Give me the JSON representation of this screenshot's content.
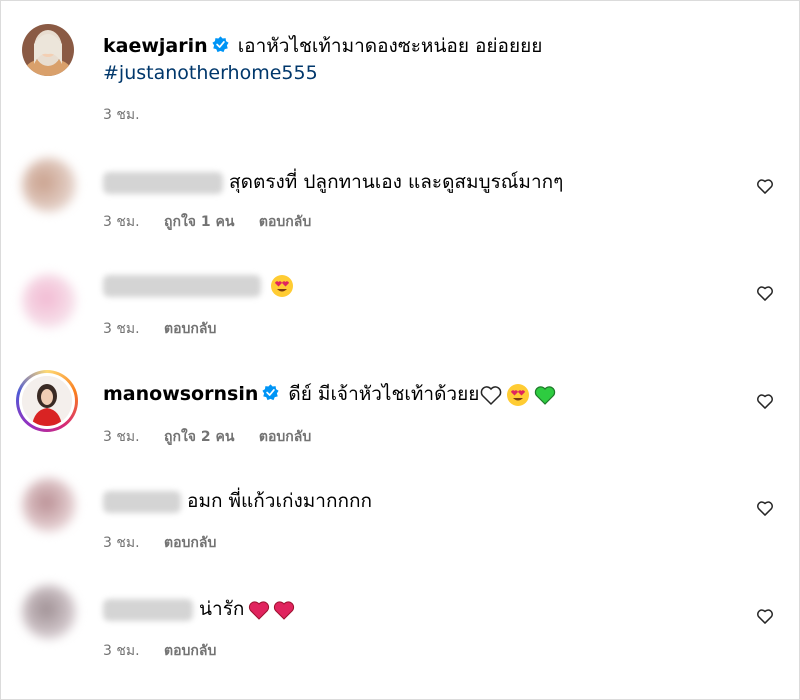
{
  "caption": {
    "username": "kaewjarin",
    "text": "เอาหัวไชเท้ามาดองซะหน่อย อย่อยยย",
    "hashtag": "#justanotherhome555",
    "time": "3 ชม."
  },
  "comments": [
    {
      "text": "สุดตรงที่ ปลูกทานเอง และดูสมบูรณ์มากๆ",
      "time": "3 ชม.",
      "likes": "ถูกใจ 1 คน",
      "reply": "ตอบกลับ"
    },
    {
      "text": "",
      "time": "3 ชม.",
      "reply": "ตอบกลับ"
    },
    {
      "username": "manowsornsin",
      "text": "ดีย์ มีเจ้าหัวไชเท้าด้วยย",
      "time": "3 ชม.",
      "likes": "ถูกใจ 2 คน",
      "reply": "ตอบกลับ"
    },
    {
      "text": "อมก พี่แก้วเก่งมากกกก",
      "time": "3 ชม.",
      "reply": "ตอบกลับ"
    },
    {
      "text": "น่ารัก",
      "time": "3 ชม.",
      "reply": "ตอบกลับ"
    }
  ],
  "colors": {
    "verified": "#0095f6",
    "hashtag": "#00376b",
    "meta": "#737373",
    "heart_red": "#e0245e",
    "heart_green": "#2ecc40"
  }
}
